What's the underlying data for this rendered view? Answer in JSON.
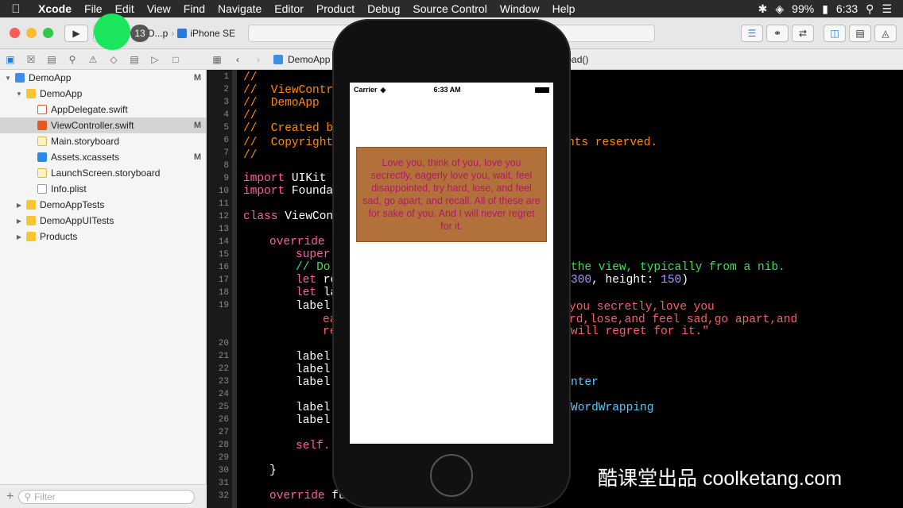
{
  "menubar": {
    "app_name": "Xcode",
    "items": [
      "File",
      "Edit",
      "View",
      "Find",
      "Navigate",
      "Editor",
      "Product",
      "Debug",
      "Source Control",
      "Window",
      "Help"
    ],
    "battery": "99%",
    "clock": "6:33"
  },
  "toolbar": {
    "scheme": "D...p",
    "device": "iPhone SE",
    "record_count": "13"
  },
  "jumpbar": {
    "file": "DemoApp",
    "symbol": "oad()"
  },
  "navigator": {
    "items": [
      {
        "label": "DemoApp",
        "badge": "M",
        "indent": 0,
        "icon": "project-icon"
      },
      {
        "label": "DemoApp",
        "badge": "",
        "indent": 1,
        "icon": "folder-icon"
      },
      {
        "label": "AppDelegate.swift",
        "badge": "",
        "indent": 2,
        "icon": "swift-file-icon"
      },
      {
        "label": "ViewController.swift",
        "badge": "M",
        "indent": 2,
        "icon": "swift-file-icon"
      },
      {
        "label": "Main.storyboard",
        "badge": "",
        "indent": 2,
        "icon": "storyboard-icon"
      },
      {
        "label": "Assets.xcassets",
        "badge": "M",
        "indent": 2,
        "icon": "assets-icon"
      },
      {
        "label": "LaunchScreen.storyboard",
        "badge": "",
        "indent": 2,
        "icon": "storyboard-icon"
      },
      {
        "label": "Info.plist",
        "badge": "",
        "indent": 2,
        "icon": "plist-icon"
      },
      {
        "label": "DemoAppTests",
        "badge": "",
        "indent": 1,
        "icon": "folder-icon"
      },
      {
        "label": "DemoAppUITests",
        "badge": "",
        "indent": 1,
        "icon": "folder-icon"
      },
      {
        "label": "Products",
        "badge": "",
        "indent": 1,
        "icon": "folder-icon"
      }
    ],
    "filter_placeholder": "Filter"
  },
  "code": {
    "line_numbers": [
      "1",
      "2",
      "3",
      "4",
      "5",
      "6",
      "7",
      "8",
      "9",
      "10",
      "11",
      "12",
      "13",
      "14",
      "15",
      "16",
      "17",
      "18",
      "19",
      "20",
      "21",
      "22",
      "23",
      "24",
      "25",
      "26",
      "27",
      "28",
      "29",
      "30",
      "31",
      "32"
    ],
    "l1": "//",
    "l2": "//  ViewContr",
    "l3": "//  DemoApp",
    "l4": "//",
    "l5": "//  Created b",
    "l6a": "//  Copyright",
    "l6b": "hts reserved.",
    "l7": "//",
    "l9kw": "import",
    "l9": " UIKit",
    "l10kw": "import",
    "l10": " Founda",
    "l12kw": "class",
    "l12": " ViewCont",
    "l14kw": "override",
    "l14": " f",
    "l15": "super.",
    "l16a": "// Do",
    "l16b": "the view, typically from a nib.",
    "l17kw": "let",
    "l17": " re",
    "l17b": "300",
    "l17c": ", height: ",
    "l17d": "150",
    "l17e": ")",
    "l18kw": "let",
    "l18": " la",
    "l19": "label.",
    "l19b": "you secretly,love you",
    "l19c": "ea",
    "l19d": "rd,lose,and feel sad,go apart,and",
    "l19e": "re",
    "l19f": "will regret for it.\"",
    "l21": "label.",
    "l22": "label.",
    "l23": "label.",
    "l23b": "nter",
    "l25": "label.",
    "l25b": "WordWrapping",
    "l26": "label.",
    "l28": "self.",
    "l30": "}",
    "l32kw": "override",
    "l32": " fu"
  },
  "simulator": {
    "carrier": "Carrier",
    "time": "6:33 AM",
    "label_text": "Love you, think of you, love you secrectly, eagerly love you, wait, feel disappointed, try hard, lose, and feel sad, go apart, and recall. All of these are for sake of you. And I will never regret for it."
  },
  "watermark": "酷课堂出品 coolketang.com"
}
